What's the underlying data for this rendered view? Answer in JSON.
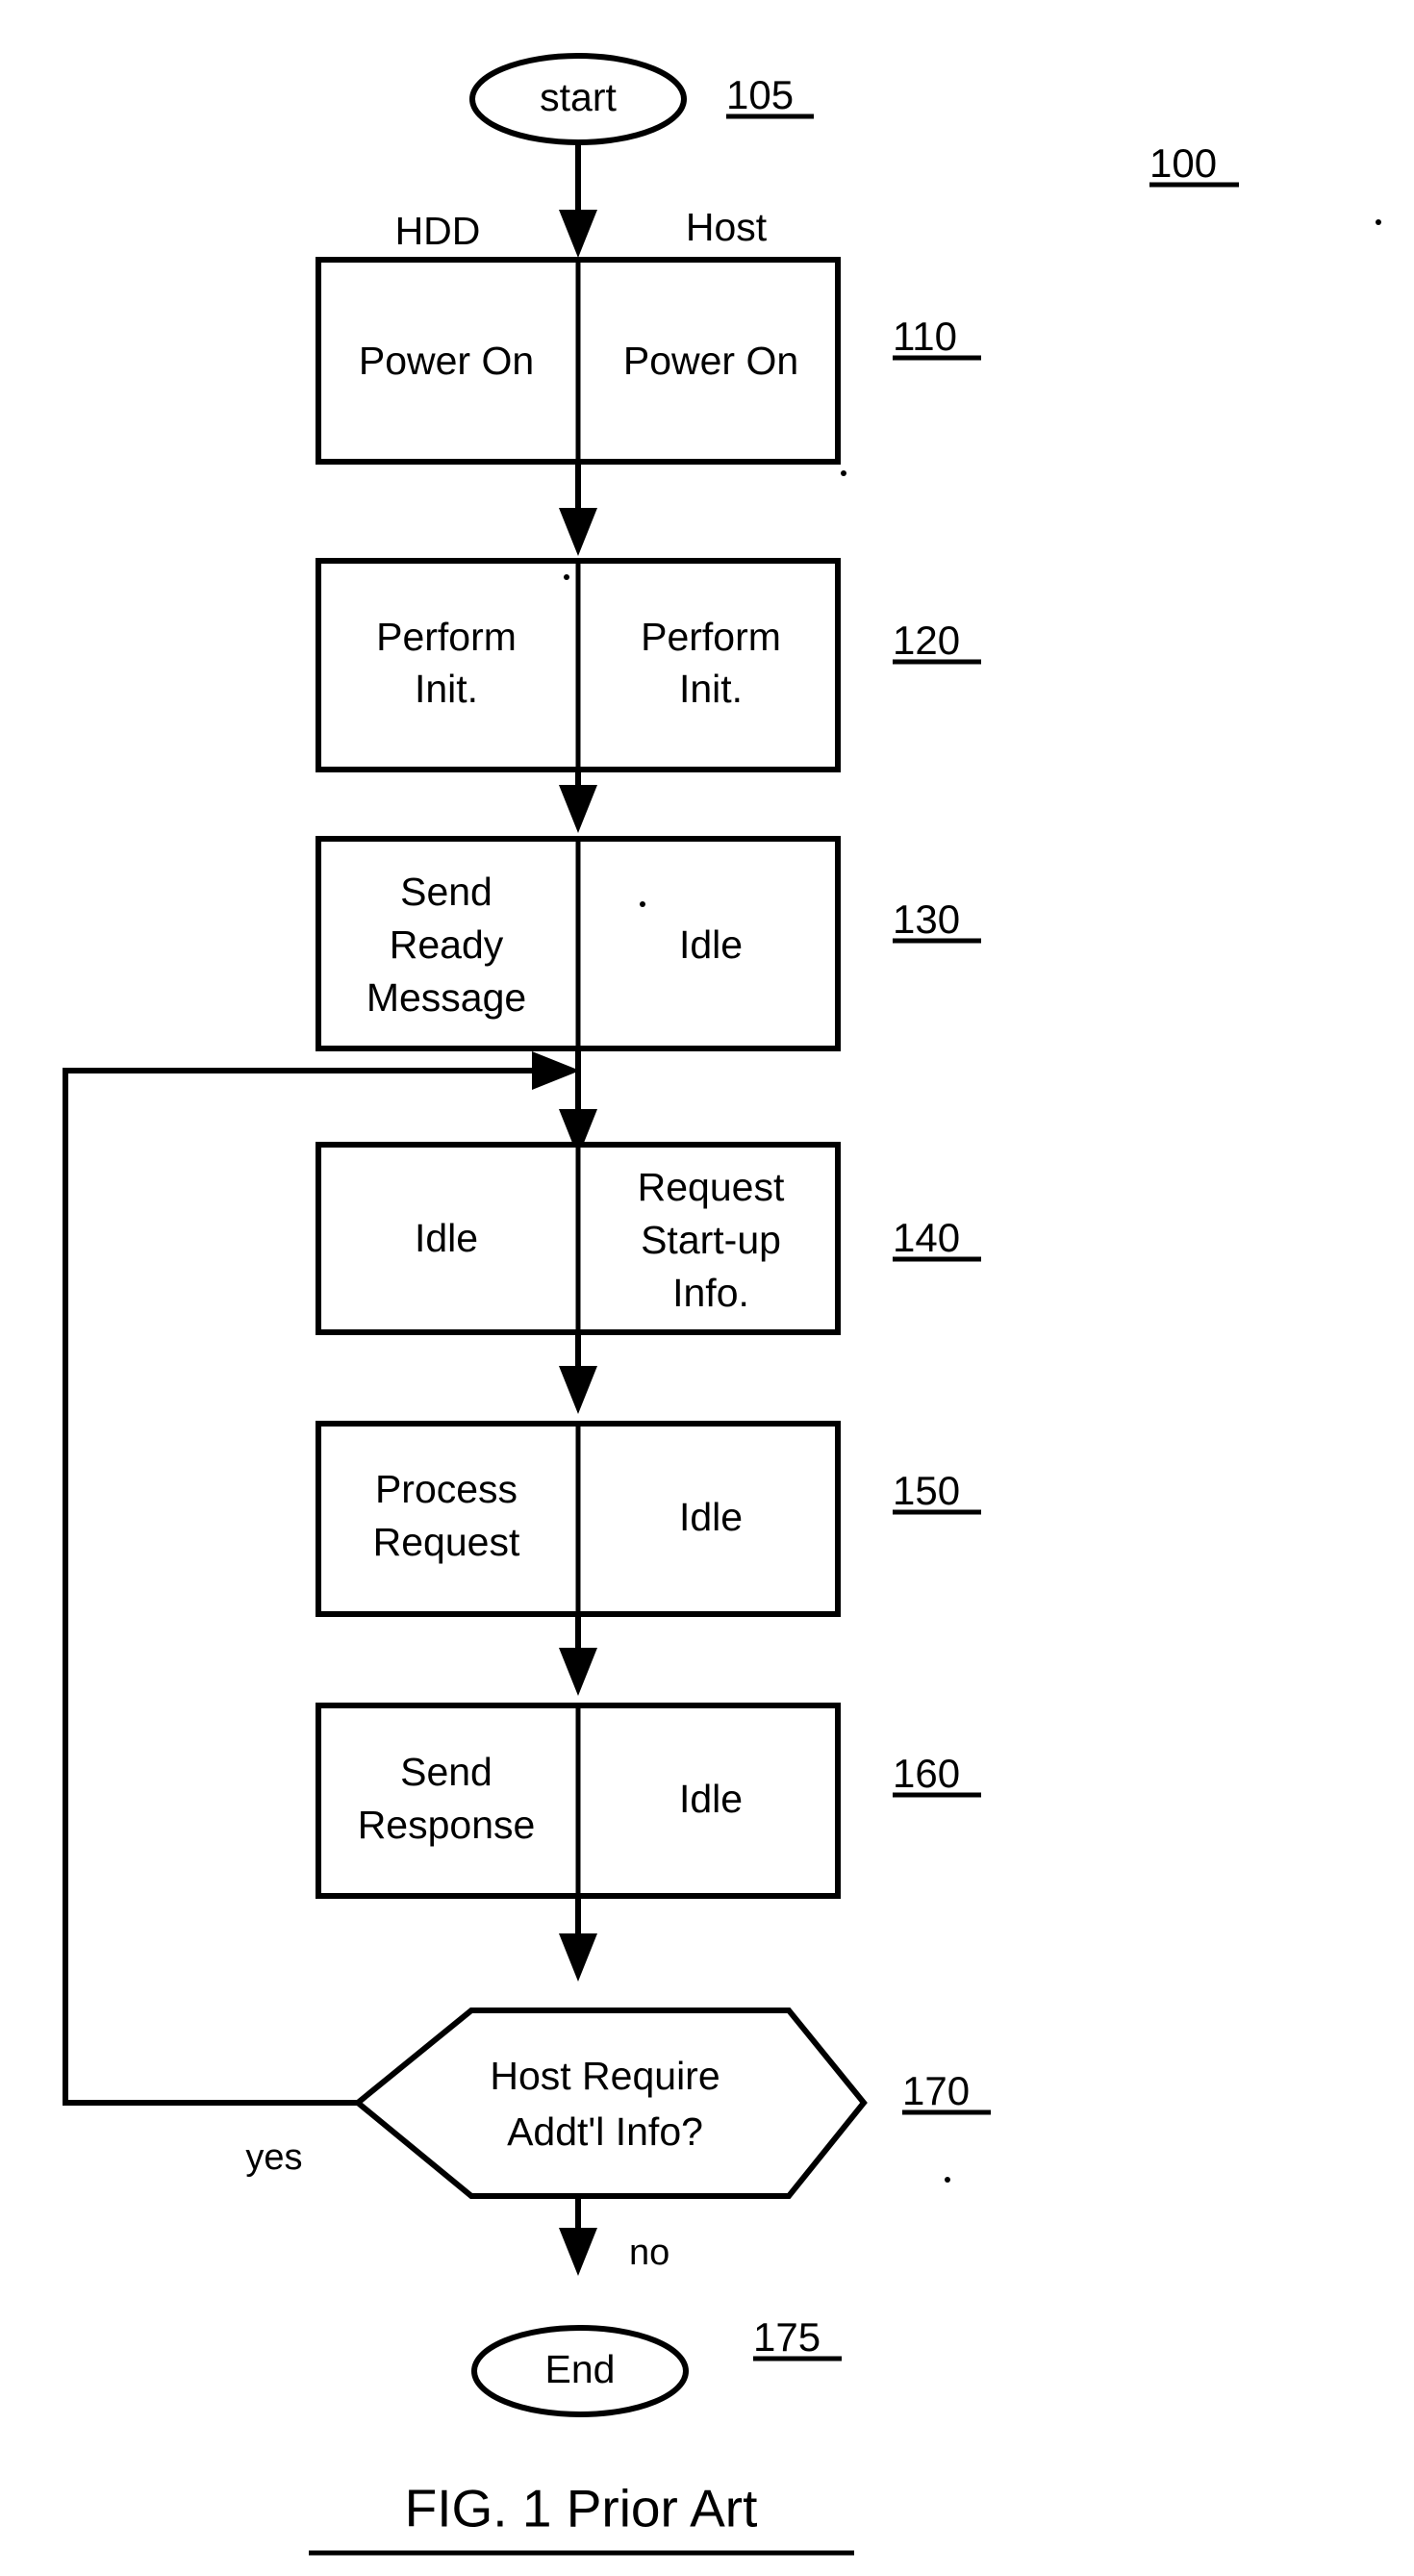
{
  "figure": {
    "caption": "FIG. 1   Prior Art",
    "figure_ref": "100"
  },
  "columns": {
    "left_header": "HDD",
    "right_header": "Host"
  },
  "nodes": {
    "start": {
      "label": "start",
      "ref": "105"
    },
    "end": {
      "label": "End",
      "ref": "175"
    },
    "decision": {
      "line1": "Host Require",
      "line2": "Addt'l Info?",
      "ref": "170"
    }
  },
  "steps": [
    {
      "ref": "110",
      "left": [
        "Power On"
      ],
      "right": [
        "Power On"
      ]
    },
    {
      "ref": "120",
      "left": [
        "Perform",
        "Init."
      ],
      "right": [
        "Perform",
        "Init."
      ]
    },
    {
      "ref": "130",
      "left": [
        "Send",
        "Ready",
        "Message"
      ],
      "right": [
        "Idle"
      ]
    },
    {
      "ref": "140",
      "left": [
        "Idle"
      ],
      "right": [
        "Request",
        "Start-up",
        "Info."
      ]
    },
    {
      "ref": "150",
      "left": [
        "Process",
        "Request"
      ],
      "right": [
        "Idle"
      ]
    },
    {
      "ref": "160",
      "left": [
        "Send",
        "Response"
      ],
      "right": [
        "Idle"
      ]
    }
  ],
  "branches": {
    "yes": "yes",
    "no": "no"
  }
}
